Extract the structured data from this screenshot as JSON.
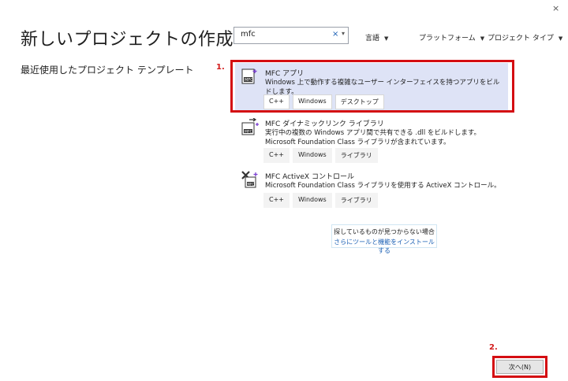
{
  "window": {
    "close_glyph": "×"
  },
  "header": {
    "title": "新しいプロジェクトの作成"
  },
  "left": {
    "recent_label": "最近使用したプロジェクト テンプレート"
  },
  "search": {
    "value": "mfc",
    "clear_glyph": "×",
    "dropdown_glyph": "▾"
  },
  "filters": [
    {
      "label": "言語"
    },
    {
      "label": "プラットフォーム"
    },
    {
      "label": "プロジェクト タイプ"
    }
  ],
  "markers": {
    "step1": "1.",
    "step2": "2."
  },
  "templates": [
    {
      "name": "MFC アプリ",
      "description": "Windows 上で動作する複雑なユーザー インターフェイスを持つアプリをビルドします。",
      "tags": [
        "C++",
        "Windows",
        "デスクトップ"
      ],
      "icon": "mfc-app-icon",
      "selected": true
    },
    {
      "name": "MFC ダイナミックリンク ライブラリ",
      "description_lines": [
        "実行中の複数の Windows アプリ間で共有できる .dll をビルドします。",
        "Microsoft Foundation Class ライブラリが含まれています。"
      ],
      "tags": [
        "C++",
        "Windows",
        "ライブラリ"
      ],
      "icon": "mfc-dll-icon",
      "selected": false
    },
    {
      "name": "MFC ActiveX コントロール",
      "description": "Microsoft Foundation Class ライブラリを使用する ActiveX コントロール。",
      "tags": [
        "C++",
        "Windows",
        "ライブラリ"
      ],
      "icon": "mfc-activex-icon",
      "selected": false
    }
  ],
  "not_found": {
    "text": "探しているものが見つからない場合",
    "link": "さらにツールと機能をインストールする"
  },
  "footer": {
    "next_label": "次へ(N)"
  },
  "colors": {
    "accent": "#1a5fb4",
    "highlight_red": "#d40d12",
    "selected_bg": "#dee3f6"
  }
}
